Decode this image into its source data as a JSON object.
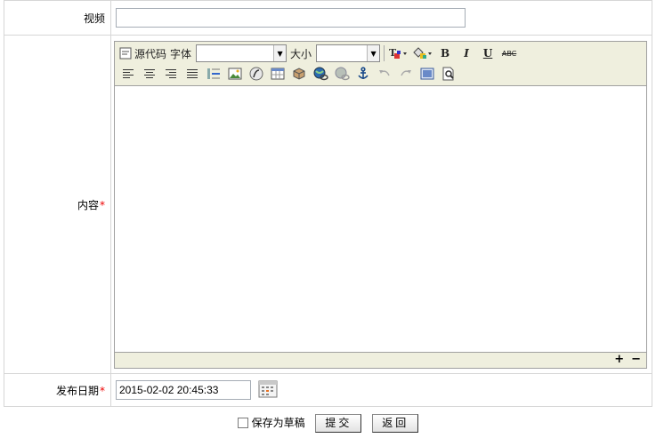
{
  "form": {
    "video_label": "视频",
    "video_value": "",
    "content_label": "内容",
    "date_label": "发布日期",
    "required_mark": "*",
    "date_value": "2015-02-02 20:45:33"
  },
  "editor": {
    "source_label": "源代码",
    "font_label": "字体",
    "size_label": "大小",
    "font_value": "",
    "size_value": "",
    "bold": "B",
    "italic": "I",
    "underline": "U",
    "strike": "ABC",
    "expand": "+",
    "shrink": "−"
  },
  "footer": {
    "draft_label": "保存为草稿",
    "submit_label": "提交",
    "back_label": "返回"
  }
}
